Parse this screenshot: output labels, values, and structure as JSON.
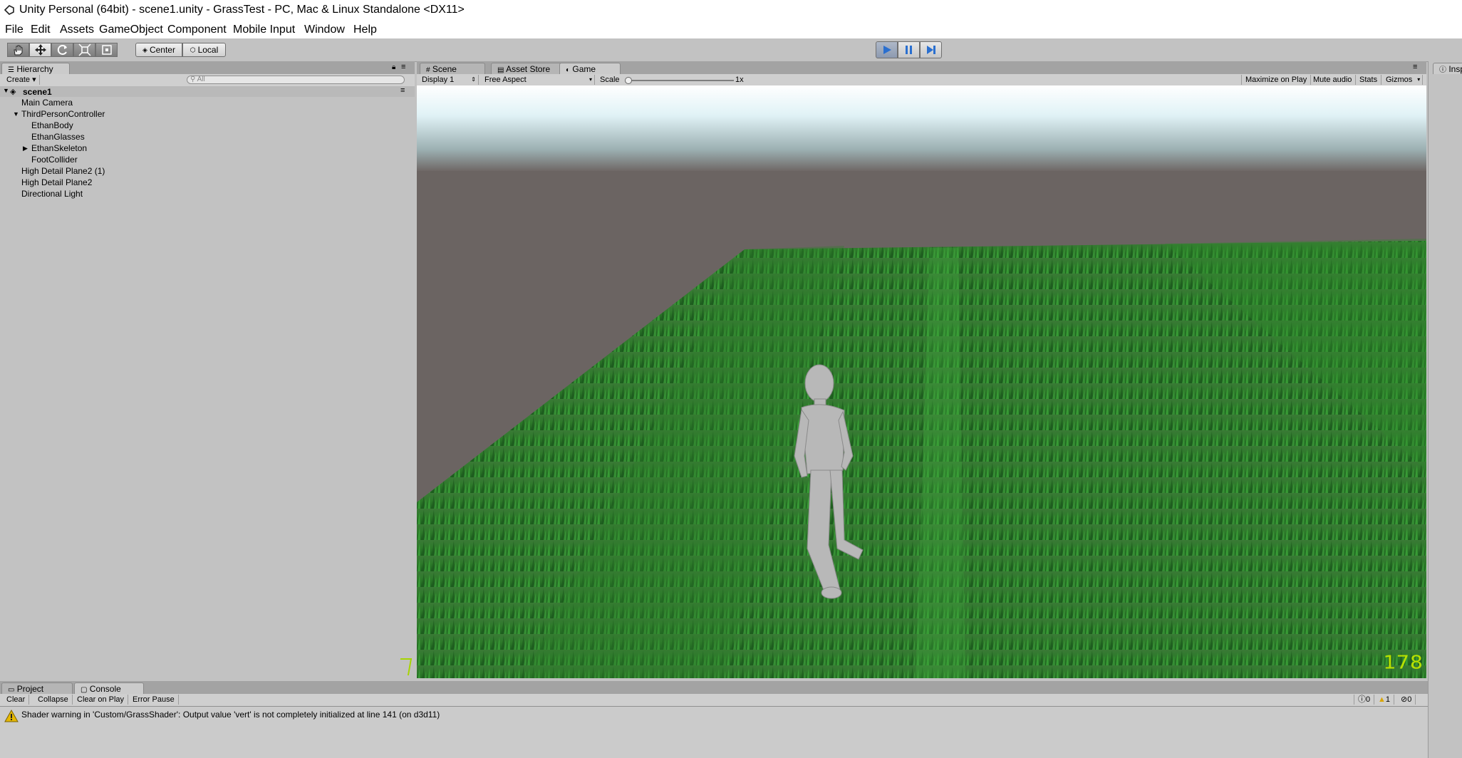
{
  "window": {
    "title": "Unity Personal (64bit) - scene1.unity - GrassTest - PC, Mac & Linux Standalone <DX11>"
  },
  "menu": [
    "File",
    "Edit",
    "Assets",
    "GameObject",
    "Component",
    "Mobile Input",
    "Window",
    "Help"
  ],
  "toolbar": {
    "tools": [
      "hand-tool-icon",
      "move-tool-icon",
      "rotate-tool-icon",
      "scale-tool-icon",
      "rect-tool-icon"
    ],
    "pivot_label": "Center",
    "space_label": "Local",
    "play_state": "playing"
  },
  "hierarchy": {
    "tab_label": "Hierarchy",
    "create_label": "Create",
    "search_placeholder": "All",
    "scene_name": "scene1",
    "items": [
      {
        "label": "Main Camera",
        "indent": 0,
        "arrow": ""
      },
      {
        "label": "ThirdPersonController",
        "indent": 0,
        "arrow": "expanded"
      },
      {
        "label": "EthanBody",
        "indent": 1,
        "arrow": ""
      },
      {
        "label": "EthanGlasses",
        "indent": 1,
        "arrow": ""
      },
      {
        "label": "EthanSkeleton",
        "indent": 1,
        "arrow": "collapsed"
      },
      {
        "label": "FootCollider",
        "indent": 1,
        "arrow": ""
      },
      {
        "label": "High Detail Plane2 (1)",
        "indent": 0,
        "arrow": ""
      },
      {
        "label": "High Detail Plane2",
        "indent": 0,
        "arrow": ""
      },
      {
        "label": "Directional Light",
        "indent": 0,
        "arrow": ""
      }
    ]
  },
  "center_tabs": [
    {
      "label": "Scene",
      "icon": "grid-icon",
      "active": false
    },
    {
      "label": "Asset Store",
      "icon": "store-icon",
      "active": false
    },
    {
      "label": "Game",
      "icon": "pacman-icon",
      "active": true
    }
  ],
  "game_bar": {
    "display": "Display 1",
    "aspect": "Free Aspect",
    "scale_label": "Scale",
    "scale_value": "1x",
    "maximize": "Maximize on Play",
    "mute": "Mute audio",
    "stats": "Stats",
    "gizmos": "Gizmos"
  },
  "inspector": {
    "tab_label": "Insp"
  },
  "game_overlay": {
    "fps": "178",
    "left_counter": "7"
  },
  "bottom_tabs": [
    {
      "label": "Project",
      "icon": "folder-icon",
      "active": false
    },
    {
      "label": "Console",
      "icon": "console-icon",
      "active": true
    }
  ],
  "console": {
    "buttons": [
      "Clear",
      "Collapse",
      "Clear on Play",
      "Error Pause"
    ],
    "info_count": "0",
    "warning_count": "1",
    "error_count": "0",
    "message": "Shader warning in 'Custom/GrassShader': Output value 'vert' is not completely initialized at line 141 (on d3d11)"
  },
  "colors": {
    "grass": "#2f8a2b",
    "grass_dark": "#1f5f20",
    "ground": "#6b6462",
    "panel": "#c2c2c2",
    "play_active": "#4f85c8",
    "overlay_text": "#b8e000"
  }
}
